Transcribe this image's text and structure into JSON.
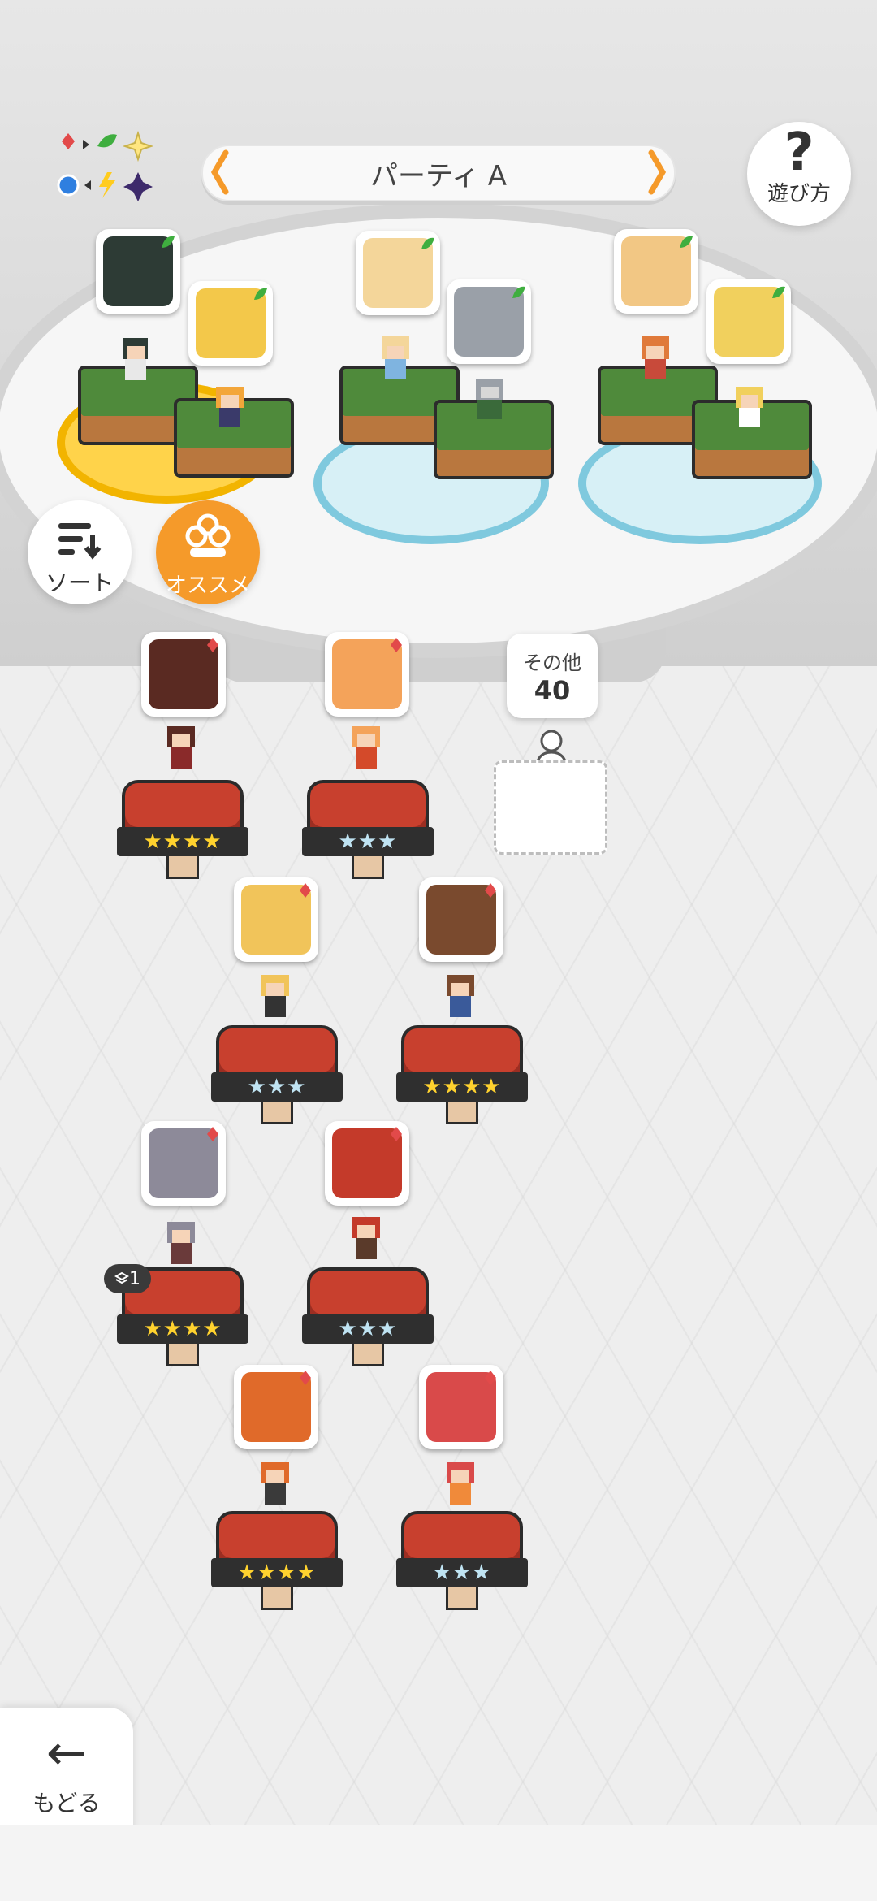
{
  "header": {
    "party_title": "パーティ A",
    "help_label": "遊び方"
  },
  "controls": {
    "sort_label": "ソート",
    "recommend_label": "オススメ"
  },
  "party": {
    "slots": [
      {
        "name": "slot-1",
        "members": [
          {
            "portrait_color": "#2d3b35"
          },
          {
            "portrait_color": "#f3c84a"
          }
        ]
      },
      {
        "name": "slot-2",
        "members": [
          {
            "portrait_color": "#f4d69a"
          },
          {
            "portrait_color": "#9aa0a8"
          }
        ]
      },
      {
        "name": "slot-3",
        "members": [
          {
            "portrait_color": "#f2c784"
          },
          {
            "portrait_color": "#f1d05d"
          }
        ]
      }
    ]
  },
  "roster": {
    "others_label": "その他",
    "others_count": "40",
    "units": [
      {
        "id": "u1",
        "rarity": "★★★★",
        "tier": "gold",
        "face": "#5a2a22"
      },
      {
        "id": "u2",
        "rarity": "★★★",
        "tier": "silver",
        "face": "#f4a35a"
      },
      {
        "id": "u3",
        "rarity": "★★★",
        "tier": "silver",
        "face": "#f1c45a"
      },
      {
        "id": "u4",
        "rarity": "★★★★",
        "tier": "gold",
        "face": "#7a4a2e"
      },
      {
        "id": "u5",
        "rarity": "★★★★",
        "tier": "gold",
        "face": "#8d8a99"
      },
      {
        "id": "u6",
        "rarity": "★★★",
        "tier": "silver",
        "face": "#c43a2a"
      },
      {
        "id": "u7",
        "rarity": "★★★★",
        "tier": "gold",
        "face": "#e06a2a"
      },
      {
        "id": "u8",
        "rarity": "★★★",
        "tier": "silver",
        "face": "#d94a4a"
      }
    ],
    "stack_badge": "1"
  },
  "footer": {
    "back_label": "もどる"
  },
  "colors": {
    "accent_orange": "#f59a2a",
    "mark_red": "#e24a4a",
    "mark_green": "#3fae3f"
  }
}
